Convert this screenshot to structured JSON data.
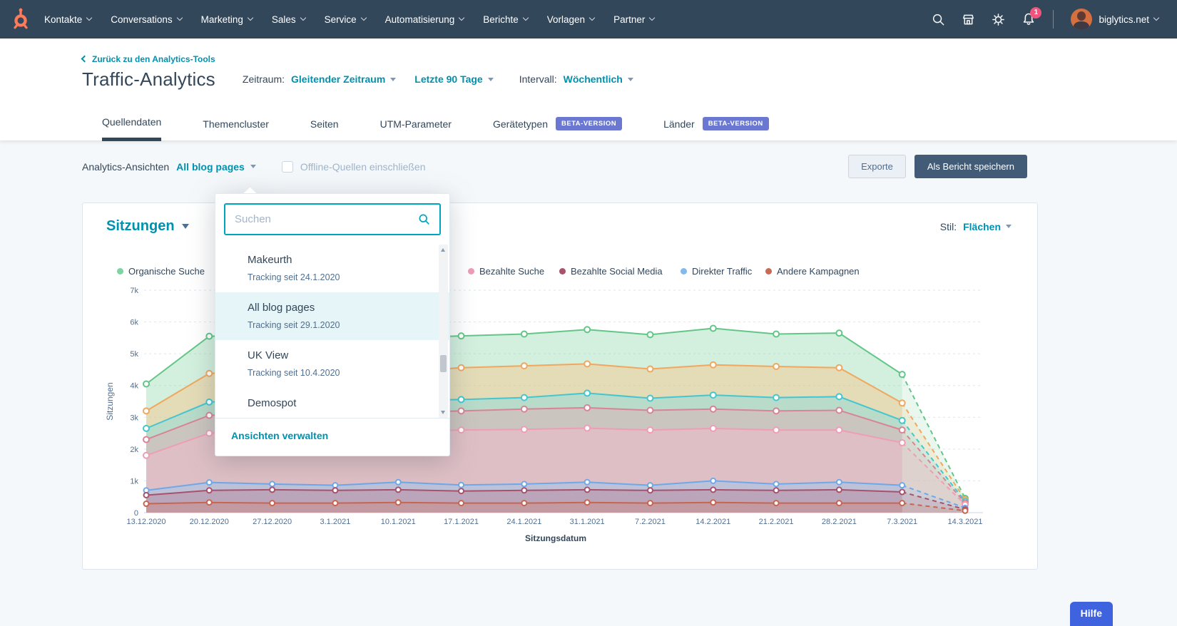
{
  "colors": {
    "nav_bg": "#33475b",
    "accent_teal": "#0091ae",
    "logo_orange": "#ff7a59",
    "beta_badge": "#6a78d1",
    "help_button": "#3f63de",
    "notification_badge": "#f2547d",
    "selected_row_bg": "#e5f5f8",
    "save_button_bg": "#425b76"
  },
  "nav": {
    "items": [
      "Kontakte",
      "Conversations",
      "Marketing",
      "Sales",
      "Service",
      "Automatisierung",
      "Berichte",
      "Vorlagen",
      "Partner"
    ],
    "notification_count": "1",
    "account_name": "biglytics.net"
  },
  "header": {
    "back_link": "Zurück zu den Analytics-Tools",
    "title": "Traffic-Analytics",
    "zeitraum_label": "Zeitraum:",
    "zeitraum_type": "Gleitender Zeitraum",
    "zeitraum_range": "Letzte 90 Tage",
    "intervall_label": "Intervall:",
    "intervall_value": "Wöchentlich"
  },
  "tabs": {
    "beta_badge": "BETA-VERSION",
    "items": [
      {
        "label": "Quellendaten",
        "active": true,
        "beta": false
      },
      {
        "label": "Themencluster",
        "active": false,
        "beta": false
      },
      {
        "label": "Seiten",
        "active": false,
        "beta": false
      },
      {
        "label": "UTM-Parameter",
        "active": false,
        "beta": false
      },
      {
        "label": "Gerätetypen",
        "active": false,
        "beta": true
      },
      {
        "label": "Länder",
        "active": false,
        "beta": true
      }
    ]
  },
  "controls": {
    "views_label": "Analytics-Ansichten",
    "views_value": "All blog pages",
    "offline_label": "Offline-Quellen einschließen",
    "offline_checked": false,
    "export_button": "Exporte",
    "save_button": "Als Bericht speichern"
  },
  "view_dropdown": {
    "search_placeholder": "Suchen",
    "items": [
      {
        "name": "Makeurth",
        "tracking": "Tracking seit 24.1.2020",
        "selected": false
      },
      {
        "name": "All blog pages",
        "tracking": "Tracking seit 29.1.2020",
        "selected": true
      },
      {
        "name": "UK View",
        "tracking": "Tracking seit 10.4.2020",
        "selected": false
      },
      {
        "name": "Demospot",
        "tracking": "",
        "selected": false
      }
    ],
    "manage_link": "Ansichten verwalten"
  },
  "chart_card": {
    "title": "Sitzungen",
    "style_label": "Stil:",
    "style_value": "Flächen",
    "legend": [
      {
        "label": "Organische Suche",
        "color": "#7cd4a0"
      },
      {
        "label": "Bezahlte Suche",
        "color": "#ee9cb7"
      },
      {
        "label": "Bezahlte Social Media",
        "color": "#a8536b"
      },
      {
        "label": "Direkter Traffic",
        "color": "#84b9ec"
      },
      {
        "label": "Andere Kampagnen",
        "color": "#c96a52"
      }
    ]
  },
  "chart_data": {
    "type": "area",
    "title": "Sitzungen",
    "xlabel": "Sitzungsdatum",
    "ylabel": "Sitzungen",
    "ylim": [
      0,
      7000
    ],
    "yticks": [
      "0",
      "1k",
      "2k",
      "3k",
      "4k",
      "5k",
      "6k",
      "7k"
    ],
    "grid": true,
    "legend_position": "top",
    "dashed_final_segment": true,
    "categories": [
      "13.12.2020",
      "20.12.2020",
      "27.12.2020",
      "3.1.2021",
      "10.1.2021",
      "17.1.2021",
      "24.1.2021",
      "31.1.2021",
      "7.2.2021",
      "14.2.2021",
      "21.2.2021",
      "28.2.2021",
      "7.3.2021",
      "14.3.2021"
    ],
    "series": [
      {
        "name": "Organische Suche",
        "color": "#63c688",
        "fill": "rgba(144,216,170,0.40)",
        "marker_r": 4,
        "values": [
          4050,
          5550,
          5600,
          5620,
          5500,
          5560,
          5620,
          5760,
          5600,
          5800,
          5620,
          5650,
          4350,
          450
        ]
      },
      {
        "name": "series-orange",
        "color": "#f0a75f",
        "fill": "rgba(248,196,138,0.45)",
        "marker_r": 4,
        "values": [
          3200,
          4380,
          4450,
          4500,
          4430,
          4560,
          4620,
          4680,
          4520,
          4650,
          4600,
          4560,
          3450,
          400
        ]
      },
      {
        "name": "series-cyan",
        "color": "#45c6cf",
        "fill": "rgba(134,219,224,0.45)",
        "marker_r": 4,
        "values": [
          2650,
          3480,
          3560,
          3600,
          3520,
          3560,
          3620,
          3760,
          3600,
          3700,
          3620,
          3650,
          2900,
          350
        ]
      },
      {
        "name": "series-rose",
        "color": "#d98396",
        "fill": "rgba(229,164,178,0.40)",
        "marker_r": 4,
        "values": [
          2300,
          3060,
          3140,
          3200,
          3150,
          3200,
          3260,
          3300,
          3220,
          3260,
          3200,
          3220,
          2600,
          300
        ]
      },
      {
        "name": "Bezahlte Suche",
        "color": "#ef9db6",
        "fill": "rgba(246,185,204,0.45)",
        "marker_r": 4,
        "values": [
          1800,
          2500,
          2560,
          2600,
          2550,
          2600,
          2620,
          2660,
          2600,
          2650,
          2600,
          2600,
          2200,
          250
        ]
      },
      {
        "name": "Direkter Traffic",
        "color": "#6ea8e8",
        "fill": "rgba(158,197,238,0.50)",
        "marker_r": 3.5,
        "values": [
          700,
          950,
          900,
          860,
          960,
          870,
          900,
          960,
          860,
          1000,
          900,
          960,
          860,
          150
        ]
      },
      {
        "name": "Bezahlte Social Media",
        "color": "#a8516a",
        "fill": "rgba(182,112,131,0.35)",
        "marker_r": 3.5,
        "values": [
          550,
          700,
          720,
          700,
          720,
          680,
          700,
          720,
          700,
          720,
          700,
          720,
          650,
          100
        ]
      },
      {
        "name": "Andere Kampagnen",
        "color": "#c7654f",
        "fill": "rgba(212,136,116,0.35)",
        "marker_r": 3.5,
        "values": [
          280,
          320,
          300,
          300,
          320,
          300,
          300,
          320,
          300,
          320,
          300,
          300,
          300,
          60
        ]
      }
    ]
  },
  "help": {
    "label": "Hilfe"
  }
}
